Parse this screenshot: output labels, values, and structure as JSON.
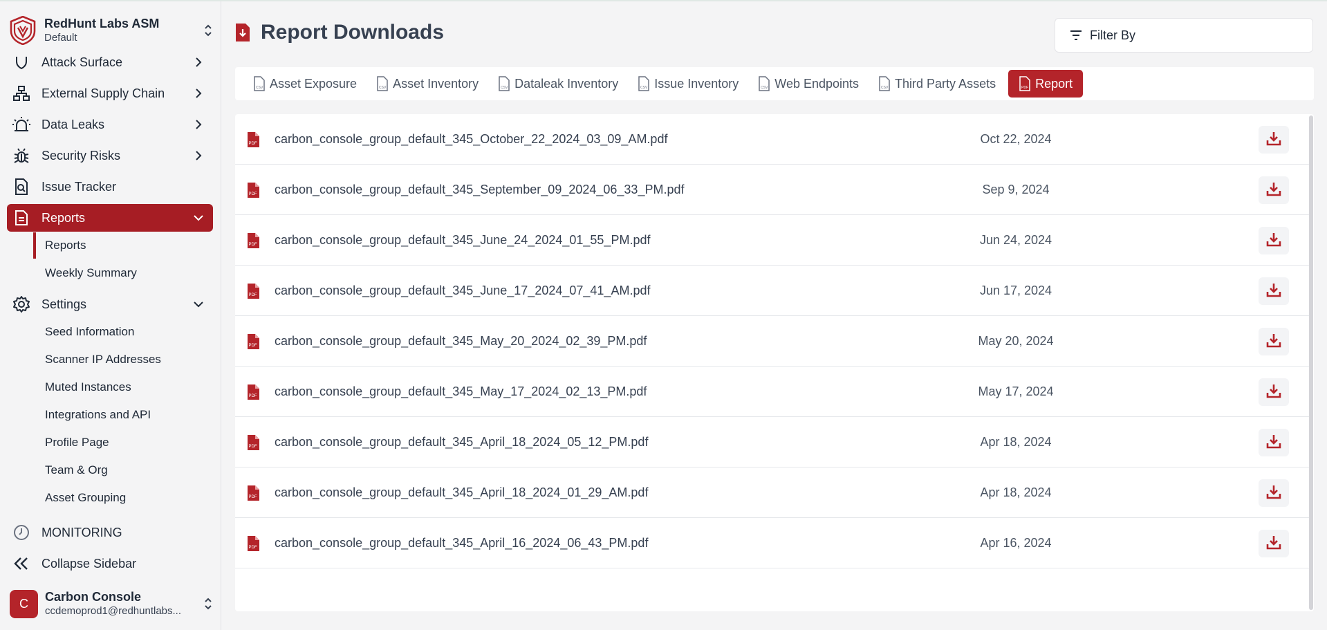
{
  "org": {
    "name": "RedHunt Labs ASM",
    "workspace": "Default"
  },
  "sidebar": {
    "items": [
      {
        "label": "Attack Surface",
        "icon": "shield-icon"
      },
      {
        "label": "External Supply Chain",
        "icon": "network-icon"
      },
      {
        "label": "Data Leaks",
        "icon": "siren-icon"
      },
      {
        "label": "Security Risks",
        "icon": "bug-icon"
      },
      {
        "label": "Issue Tracker",
        "icon": "file-search-icon"
      },
      {
        "label": "Reports",
        "icon": "document-icon"
      }
    ],
    "reports_sub": [
      "Reports",
      "Weekly Summary"
    ],
    "settings_label": "Settings",
    "settings_sub": [
      "Seed Information",
      "Scanner IP Addresses",
      "Muted Instances",
      "Integrations and API",
      "Profile Page",
      "Team & Org",
      "Asset Grouping"
    ],
    "monitoring_label": "MONITORING",
    "collapse_label": "Collapse Sidebar"
  },
  "user": {
    "initial": "C",
    "name": "Carbon Console",
    "email": "ccdemoprod1@redhuntlabs..."
  },
  "header": {
    "title": "Report Downloads",
    "filter_label": "Filter By"
  },
  "tabs": [
    "Asset Exposure",
    "Asset Inventory",
    "Dataleak Inventory",
    "Issue Inventory",
    "Web Endpoints",
    "Third Party Assets",
    "Report"
  ],
  "active_tab": "Report",
  "reports": [
    {
      "file": "carbon_console_group_default_345_October_22_2024_03_09_AM.pdf",
      "date": "Oct 22, 2024"
    },
    {
      "file": "carbon_console_group_default_345_September_09_2024_06_33_PM.pdf",
      "date": "Sep 9, 2024"
    },
    {
      "file": "carbon_console_group_default_345_June_24_2024_01_55_PM.pdf",
      "date": "Jun 24, 2024"
    },
    {
      "file": "carbon_console_group_default_345_June_17_2024_07_41_AM.pdf",
      "date": "Jun 17, 2024"
    },
    {
      "file": "carbon_console_group_default_345_May_20_2024_02_39_PM.pdf",
      "date": "May 20, 2024"
    },
    {
      "file": "carbon_console_group_default_345_May_17_2024_02_13_PM.pdf",
      "date": "May 17, 2024"
    },
    {
      "file": "carbon_console_group_default_345_April_18_2024_05_12_PM.pdf",
      "date": "Apr 18, 2024"
    },
    {
      "file": "carbon_console_group_default_345_April_18_2024_01_29_AM.pdf",
      "date": "Apr 18, 2024"
    },
    {
      "file": "carbon_console_group_default_345_April_16_2024_06_43_PM.pdf",
      "date": "Apr 16, 2024"
    }
  ],
  "colors": {
    "brand": "#a61d24",
    "accent": "#b4242a",
    "background": "#f4f4f5"
  }
}
